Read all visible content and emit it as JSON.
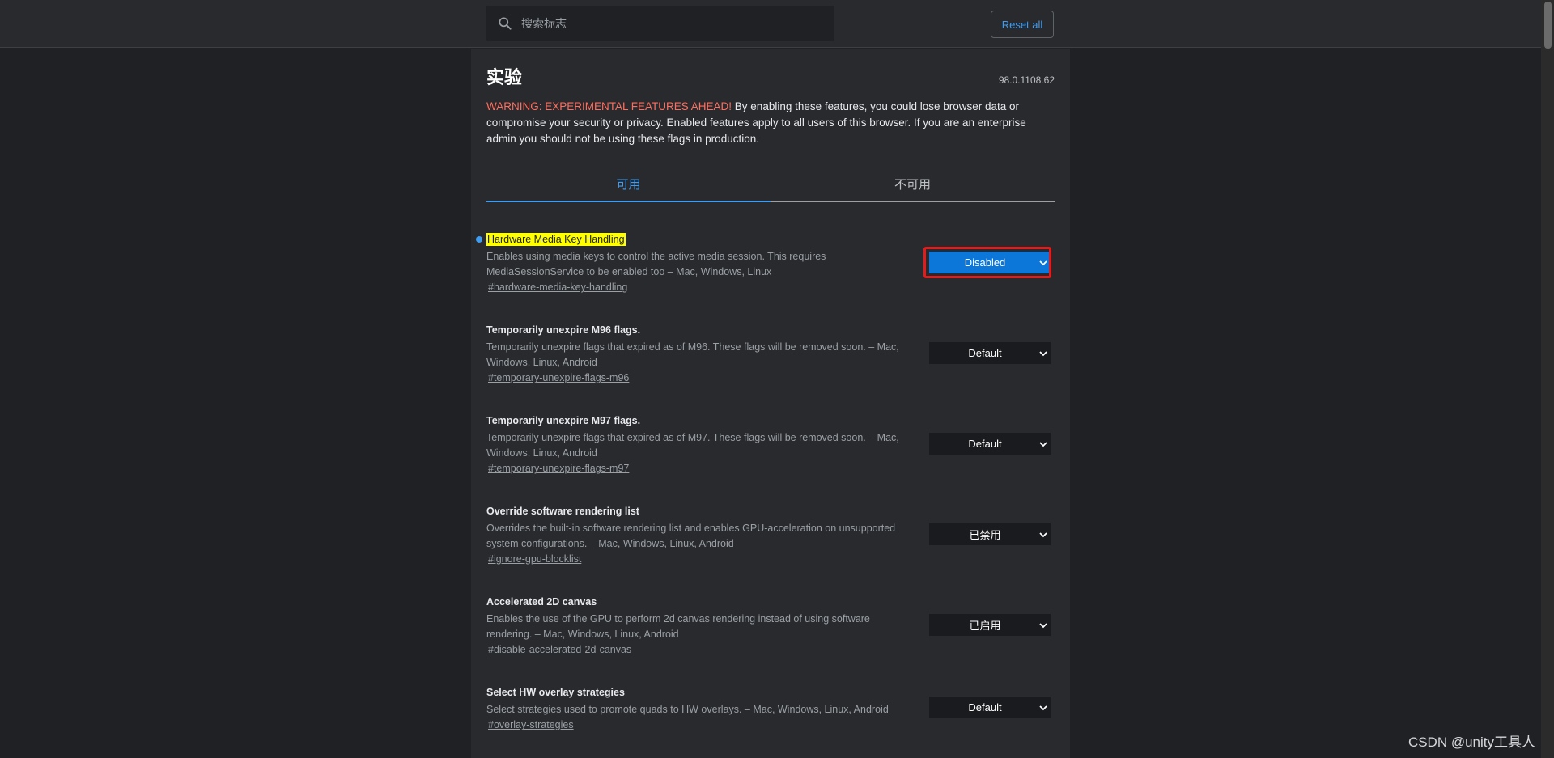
{
  "header": {
    "search_placeholder": "搜索标志",
    "reset_label": "Reset all"
  },
  "page": {
    "title": "实验",
    "version": "98.0.1108.62",
    "warning_prefix": "WARNING: EXPERIMENTAL FEATURES AHEAD!",
    "warning_text": " By enabling these features, you could lose browser data or compromise your security or privacy. Enabled features apply to all users of this browser. If you are an enterprise admin you should not be using these flags in production."
  },
  "tabs": [
    {
      "label": "可用",
      "active": true
    },
    {
      "label": "不可用",
      "active": false
    }
  ],
  "experiments": [
    {
      "title": "Hardware Media Key Handling",
      "description": "Enables using media keys to control the active media session. This requires MediaSessionService to be enabled too – Mac, Windows, Linux",
      "link": "#hardware-media-key-handling",
      "value": "Disabled",
      "modified": true
    },
    {
      "title": "Temporarily unexpire M96 flags.",
      "description": "Temporarily unexpire flags that expired as of M96. These flags will be removed soon. – Mac, Windows, Linux, Android",
      "link": "#temporary-unexpire-flags-m96",
      "value": "Default",
      "modified": false
    },
    {
      "title": "Temporarily unexpire M97 flags.",
      "description": "Temporarily unexpire flags that expired as of M97. These flags will be removed soon. – Mac, Windows, Linux, Android",
      "link": "#temporary-unexpire-flags-m97",
      "value": "Default",
      "modified": false
    },
    {
      "title": "Override software rendering list",
      "description": "Overrides the built-in software rendering list and enables GPU-acceleration on unsupported system configurations. – Mac, Windows, Linux, Android",
      "link": "#ignore-gpu-blocklist",
      "value": "已禁用",
      "modified": false
    },
    {
      "title": "Accelerated 2D canvas",
      "description": "Enables the use of the GPU to perform 2d canvas rendering instead of using software rendering. – Mac, Windows, Linux, Android",
      "link": "#disable-accelerated-2d-canvas",
      "value": "已启用",
      "modified": false
    },
    {
      "title": "Select HW overlay strategies",
      "description": "Select strategies used to promote quads to HW overlays. – Mac, Windows, Linux, Android",
      "link": "#overlay-strategies",
      "value": "Default",
      "modified": false
    }
  ],
  "watermark": "CSDN @unity工具人",
  "colors": {
    "accent": "#3f9cf0",
    "warning": "#ff6e5f",
    "highlight": "#ffff00",
    "annotation_box": "#e31b1b"
  }
}
